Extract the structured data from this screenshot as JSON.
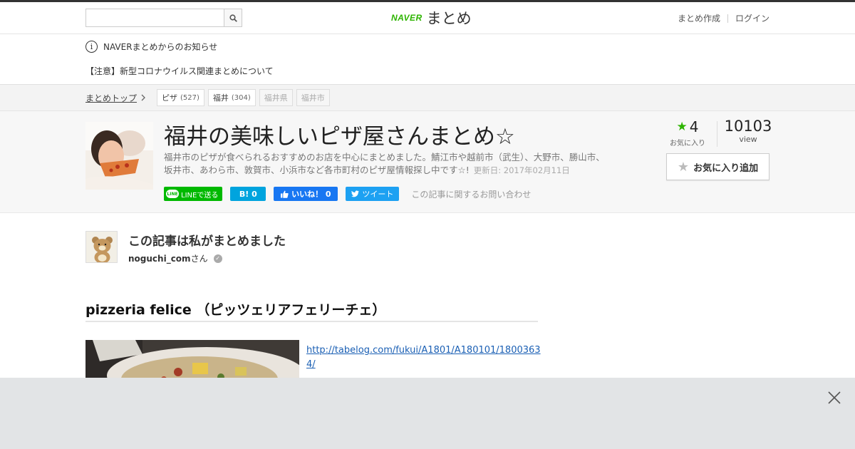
{
  "header": {
    "search": {
      "placeholder": "",
      "value": ""
    },
    "logo_naver": "NAVER",
    "logo_matome": "まとめ",
    "links": [
      "まとめ作成",
      "ログイン"
    ]
  },
  "notice": {
    "title": "NAVERまとめからのお知らせ",
    "link": "【注意】新型コロナウイルス関連まとめについて"
  },
  "breadcrumb": {
    "top": "まとめトップ",
    "tags": [
      {
        "label": "ピザ",
        "count": "(527)"
      },
      {
        "label": "福井",
        "count": "(304)"
      },
      {
        "label": "福井県",
        "count": ""
      },
      {
        "label": "福井市",
        "count": ""
      }
    ]
  },
  "article": {
    "title": "福井の美味しいピザ屋さんまとめ☆",
    "description": "福井市のピザが食べられるおすすめのお店を中心にまとめました。鯖江市や越前市（武生）、大野市、勝山市、坂井市、あわら市、敦賀市、小浜市など各市町村のピザ屋情報探し中です☆!",
    "updated": "更新日: 2017年02月11日",
    "share": {
      "line": "LINEで送る",
      "line_logo": "LINE",
      "hatena": "B! 0",
      "facebook": "いいね！ 0",
      "twitter": "ツイート"
    },
    "inquiry": "この記事に関するお問い合わせ",
    "favorites": "4",
    "favorites_label": "お気に入り",
    "views": "10103",
    "views_label": "view",
    "fav_button": "お気に入り追加"
  },
  "author": {
    "heading": "この記事は私がまとめました",
    "name": "noguchi_com",
    "suffix": "さん"
  },
  "section": {
    "heading": "pizzeria felice （ピッツェリアフェリーチェ）",
    "link": "http://tabelog.com/fukui/A1801/A180101/18003634/"
  },
  "colors": {
    "brand_green": "#2db400",
    "line_green": "#00b900",
    "hatena_blue": "#00a4de",
    "facebook_blue": "#1877f2",
    "twitter_blue": "#1da1f2",
    "overlay_gray": "#e2e4e6"
  },
  "icons": [
    "search-icon",
    "info-icon",
    "chevron-right-icon",
    "star-icon",
    "verified-check-icon",
    "close-icon",
    "facebook-like-icon",
    "twitter-bird-icon"
  ]
}
